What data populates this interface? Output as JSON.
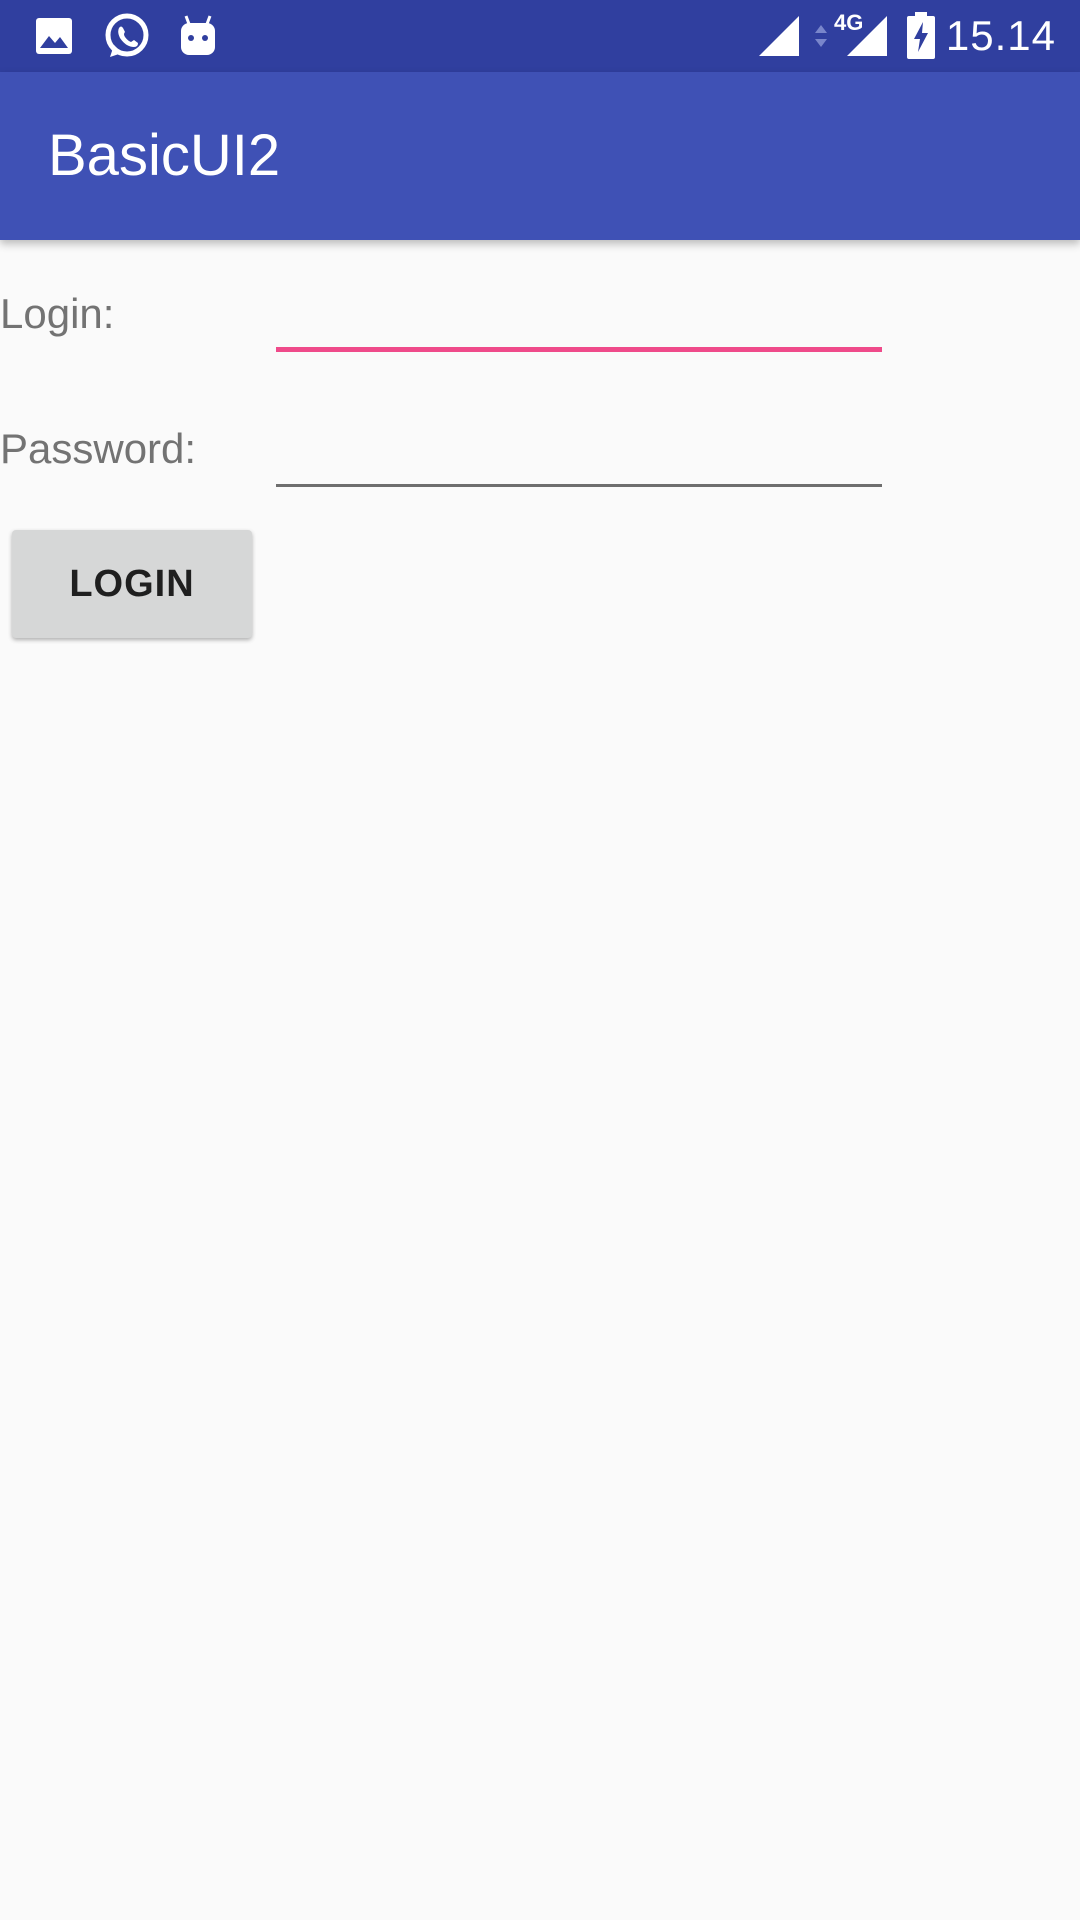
{
  "status_bar": {
    "time": "15.14",
    "network": "4G",
    "left_icons": [
      "image-icon",
      "whatsapp-icon",
      "android-icon"
    ],
    "right_icons": [
      "signal-icon",
      "data-arrows-icon",
      "signal-icon",
      "battery-charging-icon"
    ],
    "background_color": "#303f9f"
  },
  "toolbar": {
    "title": "BasicUI2",
    "background_color": "#3f51b5"
  },
  "form": {
    "login_label": "Login:",
    "login_value": "",
    "password_label": "Password:",
    "password_value": "",
    "button_label": "LOGIN",
    "focus_color": "#ef4a8a"
  }
}
